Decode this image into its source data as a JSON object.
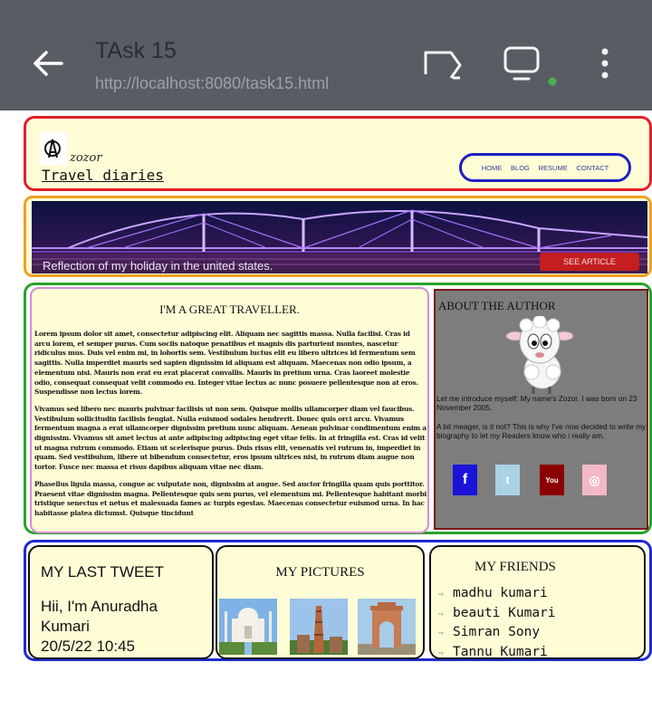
{
  "browser": {
    "title": "TAsk 15",
    "url": "http://localhost:8080/task15.html",
    "icons": [
      "back-arrow-icon",
      "cast-icon",
      "desktop-site-icon",
      "more-vert-icon"
    ],
    "status_dot_color": "#4caf50"
  },
  "header": {
    "logo_text": "zozor",
    "site_title": "Travel diaries",
    "nav": [
      "HOME",
      "BLOG",
      "RESUME",
      "CONTACT"
    ],
    "colors": {
      "border": "#e01f2a",
      "nav_border": "#1f1fc4",
      "background": "#fffdd6"
    }
  },
  "banner": {
    "caption": "Reflection of my holiday in the united states.",
    "button_label": "SEE ARTICLE",
    "colors": {
      "border": "#f0a020",
      "button": "#c41e1e"
    }
  },
  "article": {
    "title": "I'M A GREAT TRAVELLER.",
    "paragraphs": [
      "Lorem ipsum dolor sit amet, consectetur adipiscing elit. Aliquam nec sagittis massa. Nulla facilisi. Cras id arcu lorem, et semper purus. Cum sociis natoque penatibus et magnis dis parturient montes, nascetur ridiculus mus. Duis vel enim mi, in lobortis sem. Vestibulum luctus elit eu libero ultrices id fermentum sem sagittis. Nulla imperdiet mauris sed sapien dignissim id aliquam est aliquam. Maecenas non odio ipsum, a elementum nisi. Mauris non erat eu erat placerat convallis. Mauris in pretium urna. Cras laoreet molestie odio, consequat consequat velit commodo eu. Integer vitae lectus ac nunc posuere pellentesque non at eros. Suspendisse non lectus lorem.",
      "Vivamus sed libero nec mauris pulvinar facilisis ut non sem. Quisque mollis ullamcorper diam vel faucibus. Vestibulum sollicitudin facilisis feugiat. Nulla euismod sodales hendrerit. Donec quis orci arcu. Vivamus fermentum magna a erat ullamcorper dignissim pretium nunc aliquam. Aenean pulvinar condimentum enim a dignissim. Vivamus sit amet lectus at ante adipiscing adipiscing eget vitae felis. In at fringilla est. Cras id velit ut magna rutrum commodo. Etiam ut scelerisque purus. Duis risus elit, venenatis vel rutrum in, imperdiet in quam. Sed vestibulum, libere ut bibendum consectetur, eros ipsum ultrices nisi, in rutrum diam augue non tortor. Fusce nec massa et risus dapibus aliquam vitae nec diam.",
      "Phasellus ligula massa, congue ac vulputate non, dignissim at augue. Sed auctor fringilla quam quis porttitor. Praesent vitae dignissim magna. Pellentesque quis sem purus, vel elementum mi. Pellentesque habitant morbi tristique senectus et netus et malesuada fames ac turpis egestas. Maecenas consectetur euismod urna. In hac habitasse platea dictumst. Quisque tincidunt"
    ],
    "colors": {
      "outer_border": "#27a327",
      "border": "#cf8fd0"
    }
  },
  "author": {
    "title": "ABOUT THE AUTHOR",
    "bio_1": "Let me introduce myself: My name's Zozor. I was born on 23 November 2005.",
    "bio_2": "A bit meager, is it not? This is why I've now decided to write my biography to let my Readers know who i really am.",
    "social": [
      {
        "icon": "facebook-icon",
        "glyph": "f",
        "color": "#1a14d8"
      },
      {
        "icon": "twitter-icon",
        "glyph": "t",
        "color": "#a9d3e3"
      },
      {
        "icon": "youtube-icon",
        "glyph": "You",
        "color": "#8b0000"
      },
      {
        "icon": "instagram-icon",
        "glyph": "◎",
        "color": "#f2b8c6"
      }
    ],
    "colors": {
      "background": "#7d7d7d",
      "border": "#7a1717"
    }
  },
  "tweet": {
    "title": "MY LAST TWEET",
    "line_1": "Hii, I'm Anuradha",
    "line_2": "Kumari",
    "timestamp": "20/5/22 10:45"
  },
  "pictures": {
    "title": "MY PICTURES",
    "images": [
      "taj-mahal-photo",
      "qutub-minar-photo",
      "india-gate-photo"
    ]
  },
  "friends": {
    "title": "MY FRIENDS",
    "names": [
      "madhu kumari",
      "beauti Kumari",
      "Simran Sony",
      "Tannu Kumari"
    ],
    "arrow": "⇨"
  },
  "footer_colors": {
    "border": "#1f2ad0"
  }
}
